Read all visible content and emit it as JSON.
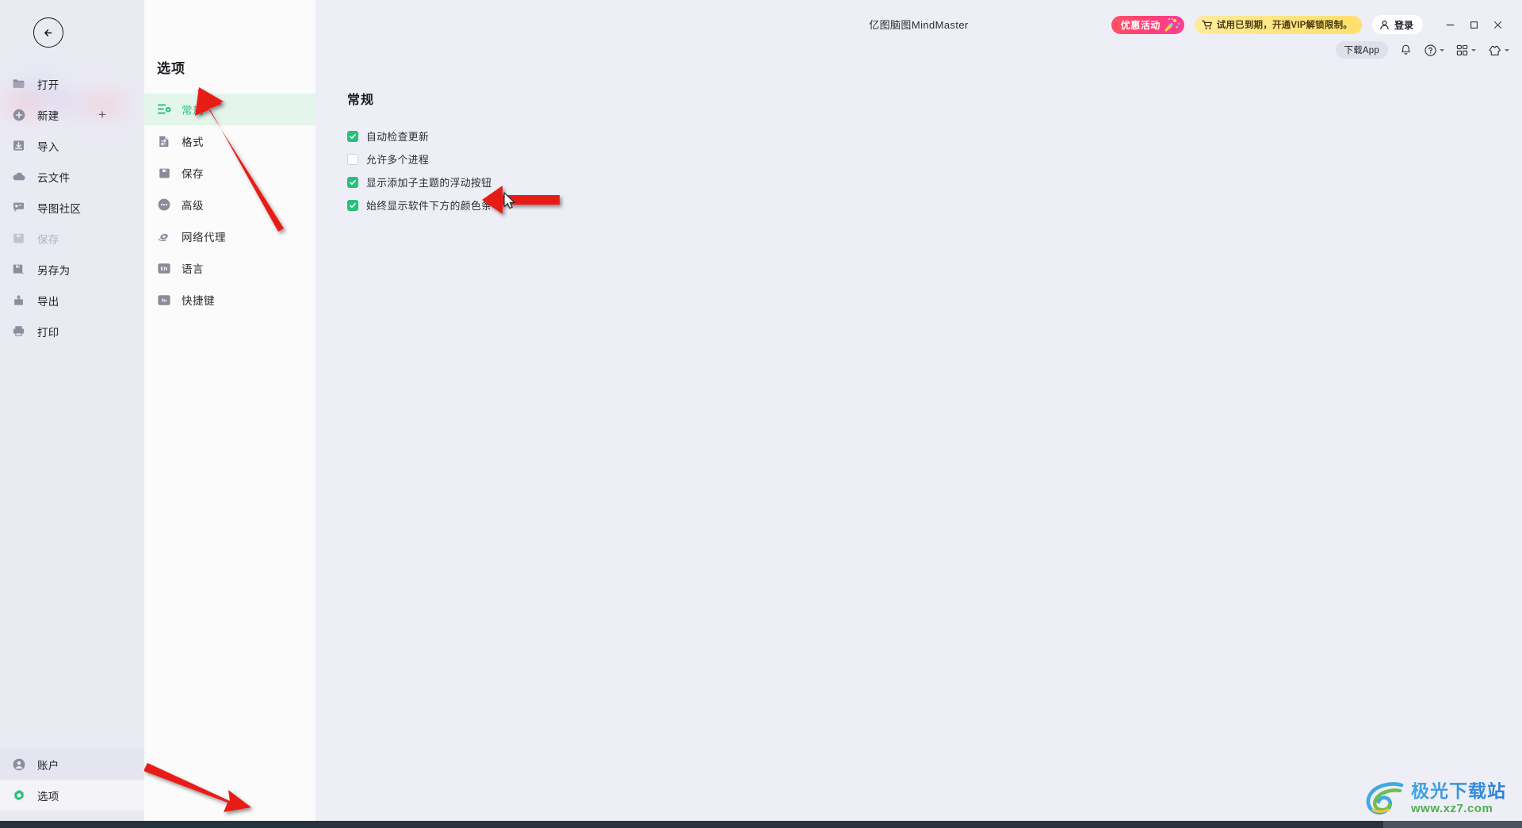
{
  "window": {
    "app_title": "亿图脑图MindMaster",
    "minimize_label": "最小化",
    "maximize_label": "最大化",
    "close_label": "关闭"
  },
  "topbar": {
    "promo_badge": "优惠活动",
    "vip_banner": "试用已到期，开通VIP解锁限制。",
    "login_label": "登录",
    "download_app_label": "下载App",
    "icons": {
      "notification": "bell-icon",
      "help": "question-circle-icon",
      "apps": "grid-apps-icon",
      "theme": "shirt-theme-icon"
    },
    "accent_red": "#ff4a6e",
    "accent_yellow": "#ffe583",
    "accent_green": "#2ec27e"
  },
  "sidebar": {
    "back_label": "返回",
    "items": [
      {
        "label": "打开",
        "icon": "folder-icon",
        "disabled": false
      },
      {
        "label": "新建",
        "icon": "plus-circle-icon",
        "disabled": false,
        "trailing": "+"
      },
      {
        "label": "导入",
        "icon": "import-icon",
        "disabled": false
      },
      {
        "label": "云文件",
        "icon": "cloud-icon",
        "disabled": false
      },
      {
        "label": "导图社区",
        "icon": "community-icon",
        "disabled": false
      },
      {
        "label": "保存",
        "icon": "save-icon",
        "disabled": true
      },
      {
        "label": "另存为",
        "icon": "save-as-icon",
        "disabled": false
      },
      {
        "label": "导出",
        "icon": "export-icon",
        "disabled": false
      },
      {
        "label": "打印",
        "icon": "print-icon",
        "disabled": false
      }
    ],
    "bottom_items": [
      {
        "label": "账户",
        "icon": "user-circle-icon",
        "active": false
      },
      {
        "label": "选项",
        "icon": "gear-icon",
        "active": true
      }
    ]
  },
  "options": {
    "title": "选项",
    "items": [
      {
        "label": "常规",
        "icon": "sliders-icon",
        "active": true
      },
      {
        "label": "格式",
        "icon": "format-icon",
        "active": false
      },
      {
        "label": "保存",
        "icon": "floppy-icon",
        "active": false
      },
      {
        "label": "高级",
        "icon": "ellipsis-icon",
        "active": false
      },
      {
        "label": "网络代理",
        "icon": "network-icon",
        "active": false
      },
      {
        "label": "语言",
        "icon": "en-icon",
        "active": false
      },
      {
        "label": "快捷键",
        "icon": "fn-key-icon",
        "active": false
      }
    ]
  },
  "main": {
    "section_title": "常规",
    "checkboxes": [
      {
        "label": "自动检查更新",
        "checked": true
      },
      {
        "label": "允许多个进程",
        "checked": false
      },
      {
        "label": "显示添加子主题的浮动按钮",
        "checked": true
      },
      {
        "label": "始终显示软件下方的颜色条",
        "checked": true
      }
    ]
  },
  "watermark": {
    "name": "极光下载站",
    "url": "www.xz7.com"
  }
}
